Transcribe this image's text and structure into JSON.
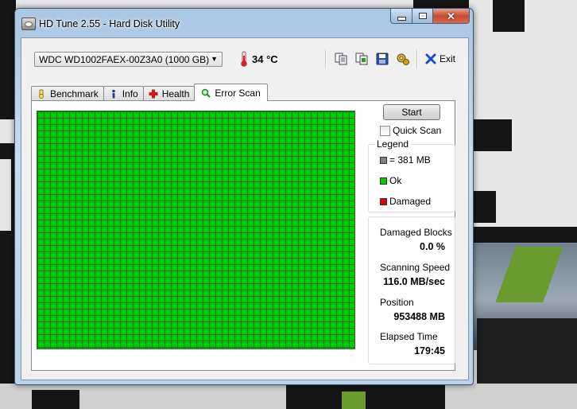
{
  "window": {
    "title": "HD Tune 2.55 - Hard Disk Utility",
    "minimize": "minimize",
    "maximize": "maximize",
    "close": "close"
  },
  "toolbar": {
    "drive": "WDC WD1002FAEX-00Z3A0 (1000 GB)",
    "temperature": "34 °C",
    "exit_label": "Exit",
    "icons": [
      "copy-text-icon",
      "copy-screenshot-icon",
      "save-icon",
      "options-icon",
      "exit-icon"
    ]
  },
  "tabs": [
    {
      "label": "Benchmark",
      "icon": "benchmark-icon"
    },
    {
      "label": "Info",
      "icon": "info-icon"
    },
    {
      "label": "Health",
      "icon": "health-icon"
    },
    {
      "label": "Error Scan",
      "icon": "magnifier-icon",
      "active": true
    }
  ],
  "scan": {
    "start_label": "Start",
    "quick_scan_label": "Quick Scan",
    "quick_scan_checked": false,
    "block_status": "Ok"
  },
  "legend": {
    "title": "Legend",
    "items": [
      {
        "label": "= 381 MB",
        "color": "#808080"
      },
      {
        "label": "Ok",
        "color": "#00cc00"
      },
      {
        "label": "Damaged",
        "color": "#dd0000"
      }
    ]
  },
  "stats": {
    "damaged_blocks_label": "Damaged Blocks",
    "damaged_blocks_value": "0.0 %",
    "speed_label": "Scanning Speed",
    "speed_value": "116.0 MB/sec",
    "position_label": "Position",
    "position_value": "953488 MB",
    "elapsed_label": "Elapsed Time",
    "elapsed_value": "179:45"
  },
  "colors": {
    "ok_block": "#00cc00",
    "grid_line": "#1e6a1e",
    "window_frame": "#a9c6e3"
  }
}
